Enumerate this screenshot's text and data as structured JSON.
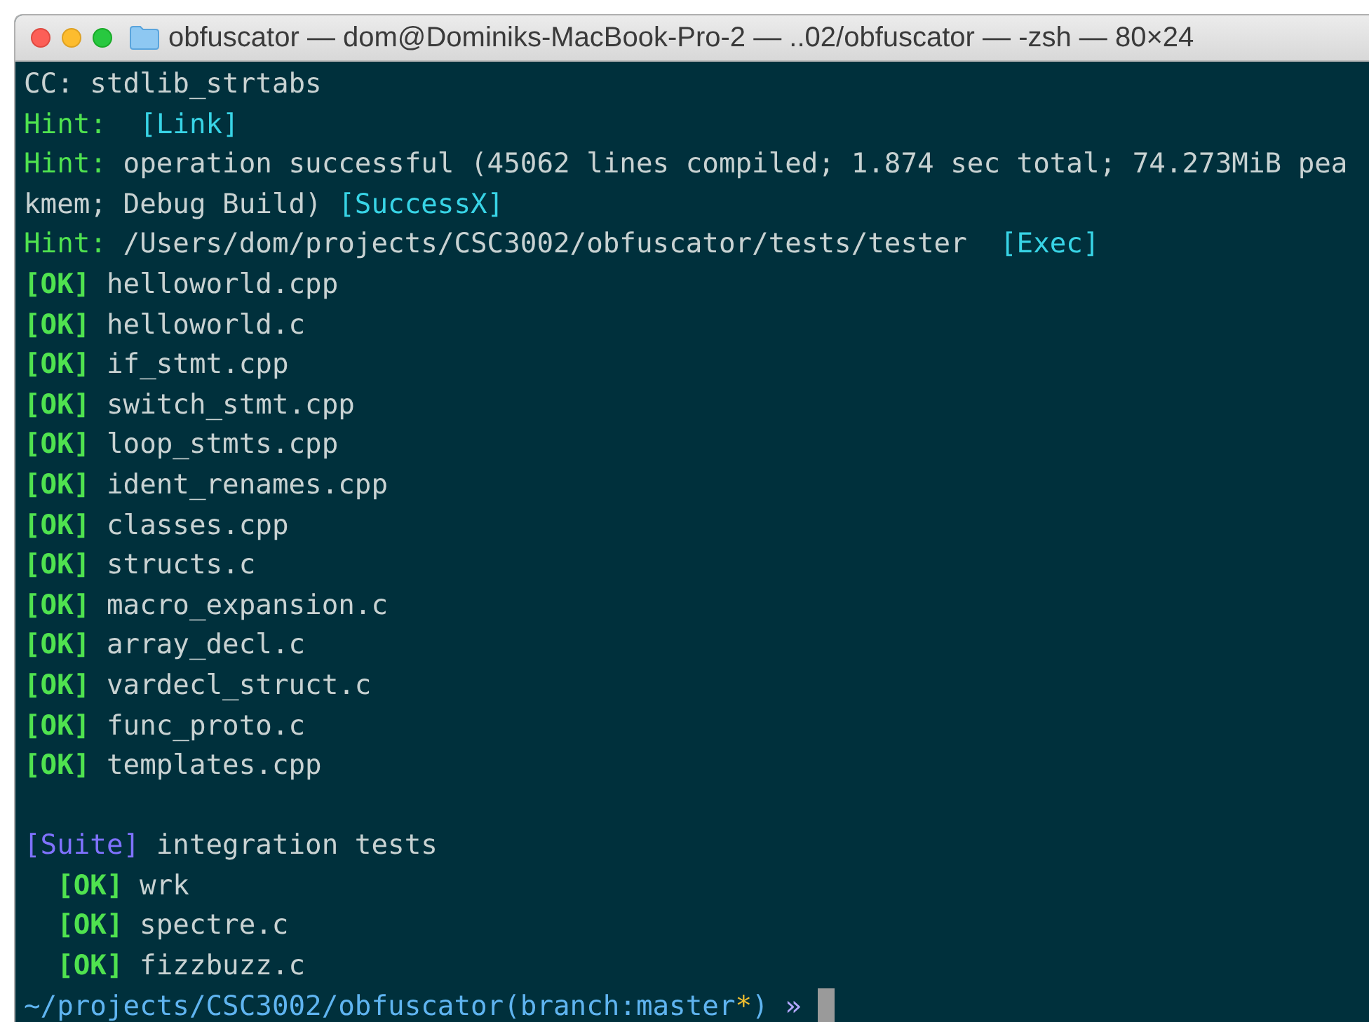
{
  "window": {
    "title": "obfuscator — dom@Dominiks-MacBook-Pro-2 — ..02/obfuscator — -zsh — 80×24"
  },
  "terminal": {
    "lines": [
      {
        "kind": "text",
        "segments": [
          {
            "kind": "plain",
            "text": "CC: stdlib_strtabs"
          }
        ]
      },
      {
        "kind": "text",
        "segments": [
          {
            "kind": "hint",
            "text": "Hint:  "
          },
          {
            "kind": "tag",
            "text": "[Link]"
          }
        ]
      },
      {
        "kind": "text",
        "segments": [
          {
            "kind": "hint",
            "text": "Hint:"
          },
          {
            "kind": "plain",
            "text": " operation successful (45062 lines compiled; 1.874 sec total; 74.273MiB pea"
          }
        ]
      },
      {
        "kind": "text",
        "segments": [
          {
            "kind": "plain",
            "text": "kmem; Debug Build) "
          },
          {
            "kind": "tag",
            "text": "[SuccessX]"
          }
        ]
      },
      {
        "kind": "text",
        "segments": [
          {
            "kind": "hint",
            "text": "Hint:"
          },
          {
            "kind": "plain",
            "text": " /Users/dom/projects/CSC3002/obfuscator/tests/tester  "
          },
          {
            "kind": "tag",
            "text": "[Exec]"
          }
        ]
      },
      {
        "kind": "text",
        "segments": [
          {
            "kind": "ok",
            "text": "[OK]"
          },
          {
            "kind": "plain",
            "text": " helloworld.cpp"
          }
        ]
      },
      {
        "kind": "text",
        "segments": [
          {
            "kind": "ok",
            "text": "[OK]"
          },
          {
            "kind": "plain",
            "text": " helloworld.c"
          }
        ]
      },
      {
        "kind": "text",
        "segments": [
          {
            "kind": "ok",
            "text": "[OK]"
          },
          {
            "kind": "plain",
            "text": " if_stmt.cpp"
          }
        ]
      },
      {
        "kind": "text",
        "segments": [
          {
            "kind": "ok",
            "text": "[OK]"
          },
          {
            "kind": "plain",
            "text": " switch_stmt.cpp"
          }
        ]
      },
      {
        "kind": "text",
        "segments": [
          {
            "kind": "ok",
            "text": "[OK]"
          },
          {
            "kind": "plain",
            "text": " loop_stmts.cpp"
          }
        ]
      },
      {
        "kind": "text",
        "segments": [
          {
            "kind": "ok",
            "text": "[OK]"
          },
          {
            "kind": "plain",
            "text": " ident_renames.cpp"
          }
        ]
      },
      {
        "kind": "text",
        "segments": [
          {
            "kind": "ok",
            "text": "[OK]"
          },
          {
            "kind": "plain",
            "text": " classes.cpp"
          }
        ]
      },
      {
        "kind": "text",
        "segments": [
          {
            "kind": "ok",
            "text": "[OK]"
          },
          {
            "kind": "plain",
            "text": " structs.c"
          }
        ]
      },
      {
        "kind": "text",
        "segments": [
          {
            "kind": "ok",
            "text": "[OK]"
          },
          {
            "kind": "plain",
            "text": " macro_expansion.c"
          }
        ]
      },
      {
        "kind": "text",
        "segments": [
          {
            "kind": "ok",
            "text": "[OK]"
          },
          {
            "kind": "plain",
            "text": " array_decl.c"
          }
        ]
      },
      {
        "kind": "text",
        "segments": [
          {
            "kind": "ok",
            "text": "[OK]"
          },
          {
            "kind": "plain",
            "text": " vardecl_struct.c"
          }
        ]
      },
      {
        "kind": "text",
        "segments": [
          {
            "kind": "ok",
            "text": "[OK]"
          },
          {
            "kind": "plain",
            "text": " func_proto.c"
          }
        ]
      },
      {
        "kind": "text",
        "segments": [
          {
            "kind": "ok",
            "text": "[OK]"
          },
          {
            "kind": "plain",
            "text": " templates.cpp"
          }
        ]
      },
      {
        "kind": "blank"
      },
      {
        "kind": "text",
        "segments": [
          {
            "kind": "suite",
            "text": "[Suite]"
          },
          {
            "kind": "plain",
            "text": " integration tests"
          }
        ]
      },
      {
        "kind": "text",
        "indent": true,
        "segments": [
          {
            "kind": "ok",
            "text": "[OK]"
          },
          {
            "kind": "plain",
            "text": " wrk"
          }
        ]
      },
      {
        "kind": "text",
        "indent": true,
        "segments": [
          {
            "kind": "ok",
            "text": "[OK]"
          },
          {
            "kind": "plain",
            "text": " spectre.c"
          }
        ]
      },
      {
        "kind": "text",
        "indent": true,
        "segments": [
          {
            "kind": "ok",
            "text": "[OK]"
          },
          {
            "kind": "plain",
            "text": " fizzbuzz.c"
          }
        ]
      },
      {
        "kind": "prompt",
        "segments": [
          {
            "kind": "path",
            "text": "~/projects/CSC3002/obfuscator(branch:master"
          },
          {
            "kind": "dirty",
            "text": "*"
          },
          {
            "kind": "path",
            "text": ")"
          },
          {
            "kind": "arrow",
            "text": "»"
          }
        ]
      }
    ]
  }
}
